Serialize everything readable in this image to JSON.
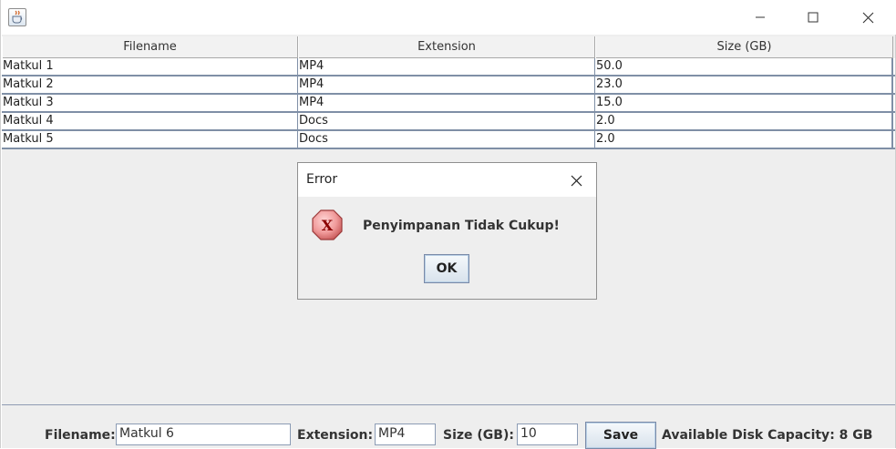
{
  "window": {
    "icon": "java-cup-icon",
    "controls": [
      "minimize-icon",
      "maximize-icon",
      "close-icon"
    ]
  },
  "table": {
    "headers": [
      "Filename",
      "Extension",
      "Size (GB)"
    ],
    "rows": [
      [
        "Matkul 1",
        "MP4",
        "50.0"
      ],
      [
        "Matkul 2",
        "MP4",
        "23.0"
      ],
      [
        "Matkul 3",
        "MP4",
        "15.0"
      ],
      [
        "Matkul 4",
        "Docs",
        "2.0"
      ],
      [
        "Matkul 5",
        "Docs",
        "2.0"
      ]
    ]
  },
  "dialog": {
    "title": "Error",
    "message": "Penyimpanan Tidak Cukup!",
    "ok_label": "OK",
    "icon": "error-x-icon",
    "icon_letter": "X"
  },
  "form": {
    "filename_label": "Filename:",
    "filename_value": "Matkul 6",
    "extension_label": "Extension:",
    "extension_value": "MP4",
    "size_label": "Size (GB):",
    "size_value": "10",
    "save_label": "Save",
    "capacity_text": "Available Disk Capacity: 8 GB"
  }
}
